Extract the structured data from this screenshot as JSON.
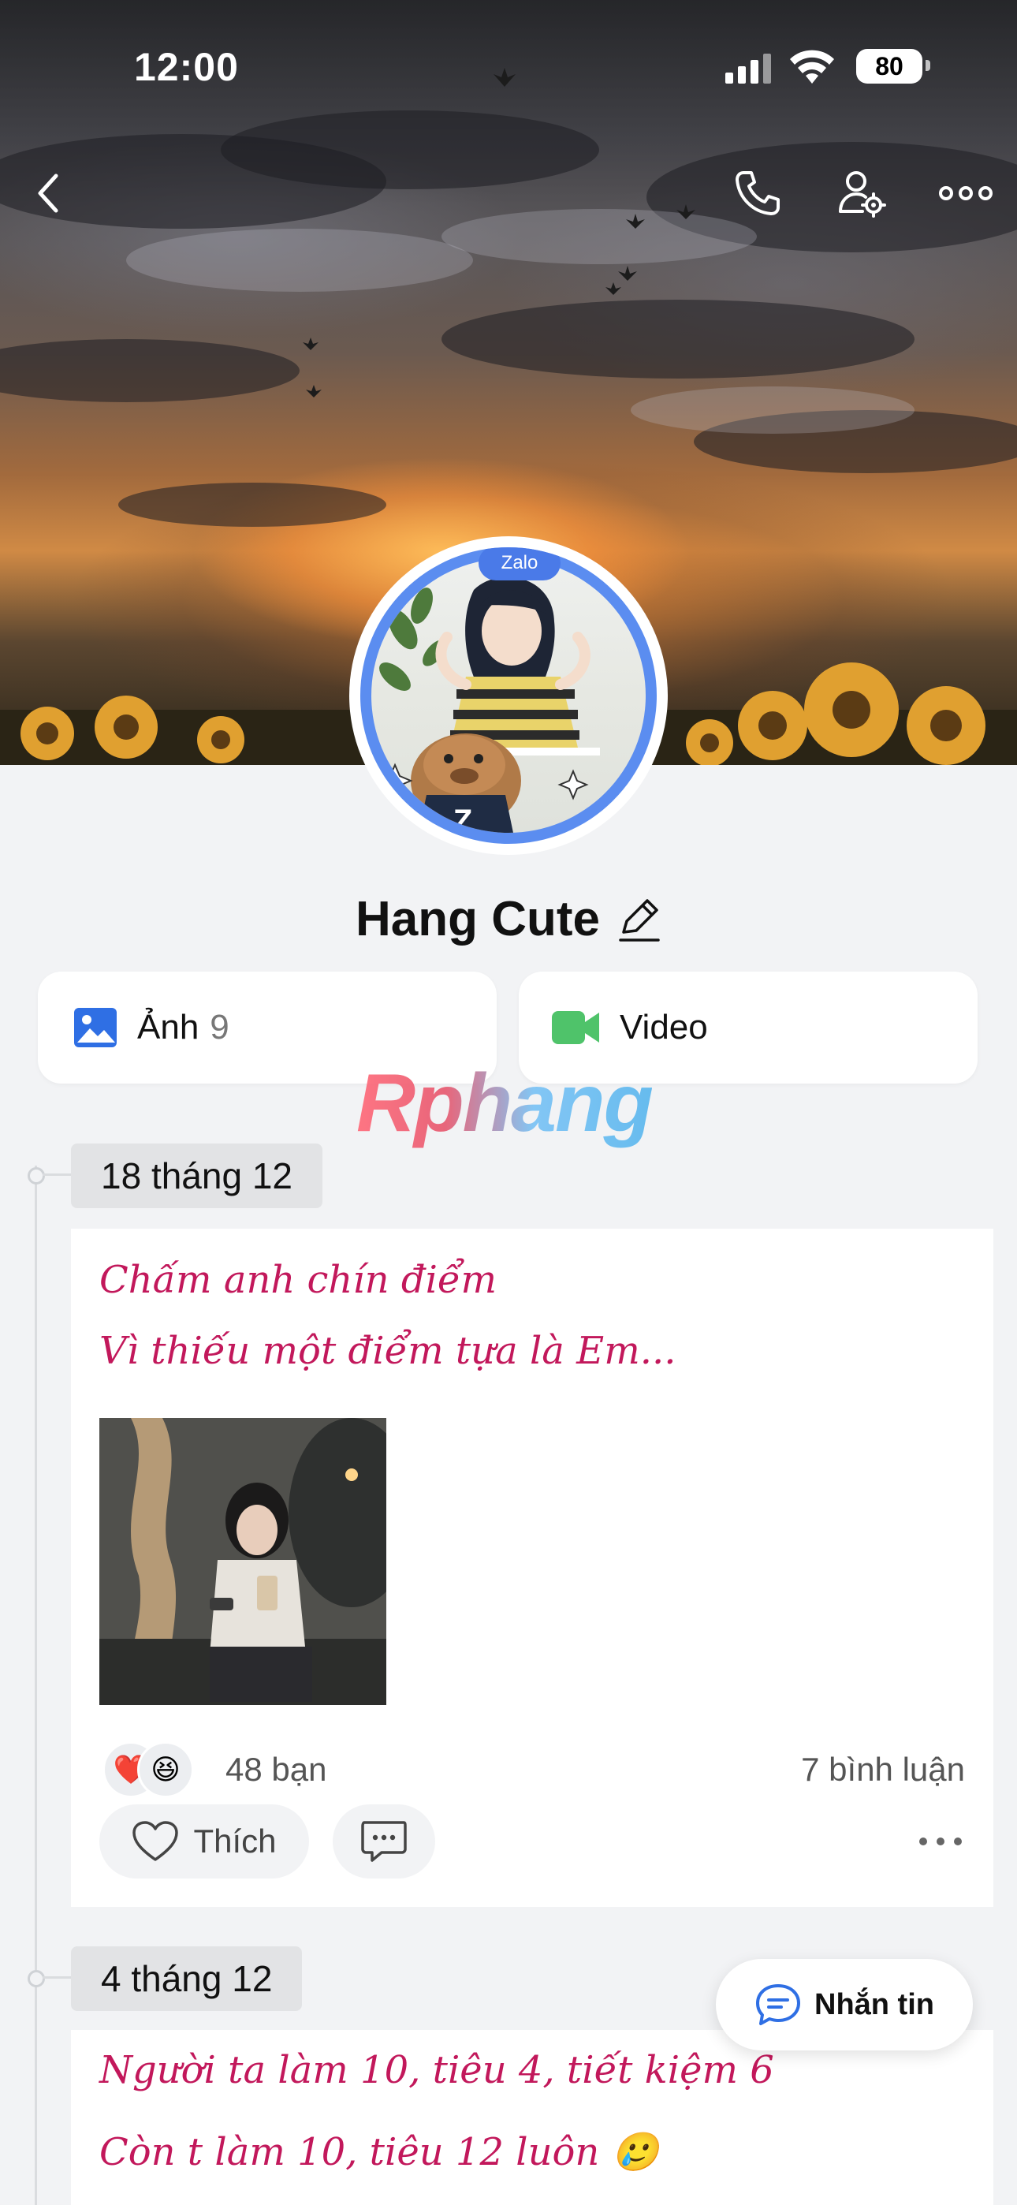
{
  "status_bar": {
    "time": "12:00",
    "battery": "80"
  },
  "header": {
    "back_icon": "chevron-left-icon",
    "call_icon": "phone-icon",
    "settings_icon": "user-gear-icon",
    "more_icon": "more-horizontal-icon"
  },
  "avatar": {
    "badge": "Zalo"
  },
  "profile": {
    "name": "Hang Cute",
    "edit_icon": "pencil-icon"
  },
  "media_tiles": {
    "photos": {
      "label": "Ảnh",
      "count": "9",
      "icon": "image-icon",
      "color": "#2f6fe4"
    },
    "video": {
      "label": "Video",
      "icon": "video-camera-icon",
      "color": "#4fc36a"
    }
  },
  "watermark": "Rphang",
  "posts": [
    {
      "date": "18 tháng 12",
      "lines": [
        "Chấm anh chín điểm",
        "Vì thiếu một điểm tựa là Em..."
      ],
      "reactions": {
        "emojis": [
          "❤️",
          "😆"
        ],
        "count_text": "48 bạn"
      },
      "comments_text": "7 bình luận",
      "like_label": "Thích"
    },
    {
      "date": "4 tháng 12",
      "lines": [
        "Người ta làm 10, tiêu 4, tiết kiệm 6",
        "Còn t làm 10, tiêu 12 luôn 🥲"
      ]
    }
  ],
  "fab": {
    "label": "Nhắn tin",
    "icon": "chat-bubble-icon",
    "color": "#2f6fe4"
  },
  "colors": {
    "post_text": "#c2185b",
    "page_bg": "#f2f3f5"
  }
}
